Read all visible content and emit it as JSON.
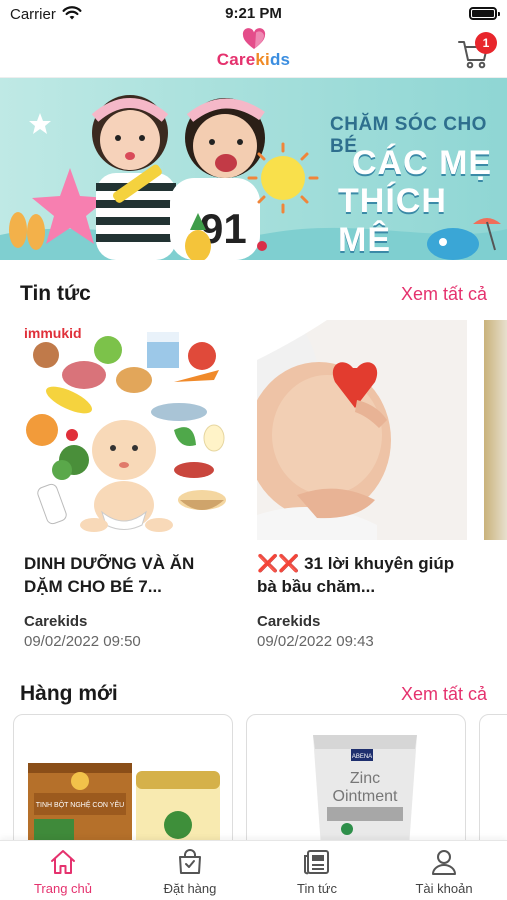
{
  "status_bar": {
    "carrier": "Carrier",
    "time": "9:21 PM"
  },
  "header": {
    "logo": {
      "part1": "Care",
      "part2": "ki",
      "part3": "ds"
    },
    "cart_badge": "1"
  },
  "banner": {
    "line1": "CHĂM SÓC CHO BÉ",
    "line2": "CÁC MẸ",
    "line3": "THÍCH MÊ"
  },
  "news_section": {
    "title": "Tin tức",
    "see_all": "Xem tất cả",
    "items": [
      {
        "image_label": "immukid",
        "title": "DINH DƯỠNG VÀ ĂN DẶM CHO BÉ 7...",
        "author": "Carekids",
        "date": "09/02/2022 09:50"
      },
      {
        "title_marks": "❌❌",
        "title": "31 lời khuyên giúp bà bầu chăm...",
        "author": "Carekids",
        "date": "09/02/2022 09:43"
      }
    ]
  },
  "products_section": {
    "title": "Hàng mới",
    "see_all": "Xem tất cả",
    "items": [
      {
        "box_text": "TINH BỘT NGHỆ CON YÊU"
      },
      {
        "brand": "ABENA",
        "name_line1": "Zinc",
        "name_line2": "Ointment"
      }
    ]
  },
  "tabbar": {
    "tabs": [
      {
        "label": "Trang chủ",
        "icon": "home-icon",
        "active": true
      },
      {
        "label": "Đặt hàng",
        "icon": "shopping-bag-icon",
        "active": false
      },
      {
        "label": "Tin tức",
        "icon": "newspaper-icon",
        "active": false
      },
      {
        "label": "Tài khoản",
        "icon": "user-icon",
        "active": false
      }
    ]
  },
  "colors": {
    "accent": "#e5326e",
    "badge": "#e8262c",
    "banner_bg": "#a8e0dc"
  }
}
